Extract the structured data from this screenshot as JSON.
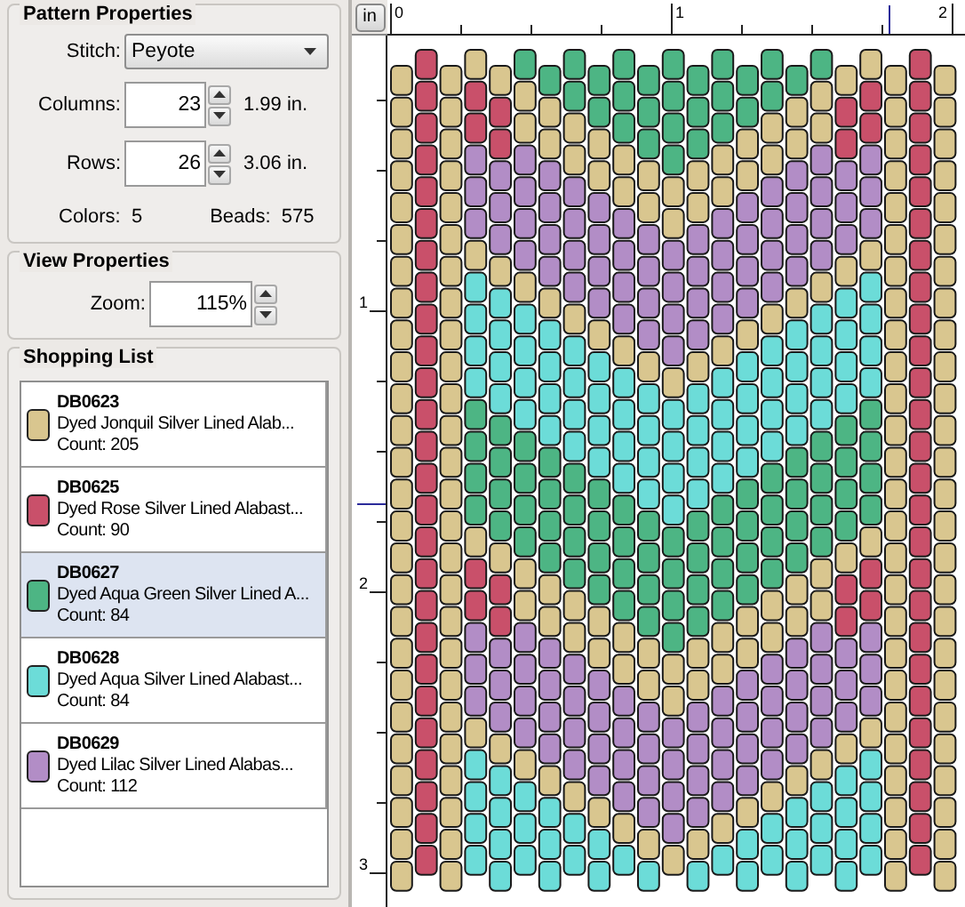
{
  "pattern_properties": {
    "title": "Pattern Properties",
    "stitch": {
      "label": "Stitch:",
      "value": "Peyote"
    },
    "columns": {
      "label": "Columns:",
      "value": "23",
      "measure": "1.99 in."
    },
    "rows": {
      "label": "Rows:",
      "value": "26",
      "measure": "3.06 in."
    },
    "colors": {
      "label": "Colors:",
      "value": "5"
    },
    "beads": {
      "label": "Beads:",
      "value": "575"
    }
  },
  "view_properties": {
    "title": "View Properties",
    "zoom": {
      "label": "Zoom:",
      "value": "115%"
    }
  },
  "shopping_list": {
    "title": "Shopping List",
    "items": [
      {
        "code": "DB0623",
        "name": "Dyed Jonquil Silver Lined Alab...",
        "count": "Count: 205",
        "color": "#d9c68f",
        "selected": false
      },
      {
        "code": "DB0625",
        "name": "Dyed Rose Silver Lined Alabast...",
        "count": "Count: 90",
        "color": "#c9506a",
        "selected": false
      },
      {
        "code": "DB0627",
        "name": "Dyed Aqua Green Silver Lined A...",
        "count": "Count: 84",
        "color": "#4db584",
        "selected": true
      },
      {
        "code": "DB0628",
        "name": "Dyed Aqua Silver Lined Alabast...",
        "count": "Count: 84",
        "color": "#6cdcd8",
        "selected": false
      },
      {
        "code": "DB0629",
        "name": "Dyed Lilac Silver Lined Alabas...",
        "count": "Count: 112",
        "color": "#b28dc6",
        "selected": false
      }
    ]
  },
  "canvas": {
    "unit_button": "in",
    "top_ruler": [
      "0",
      "1",
      "2"
    ],
    "left_ruler": [
      "1",
      "2",
      "3"
    ]
  }
}
